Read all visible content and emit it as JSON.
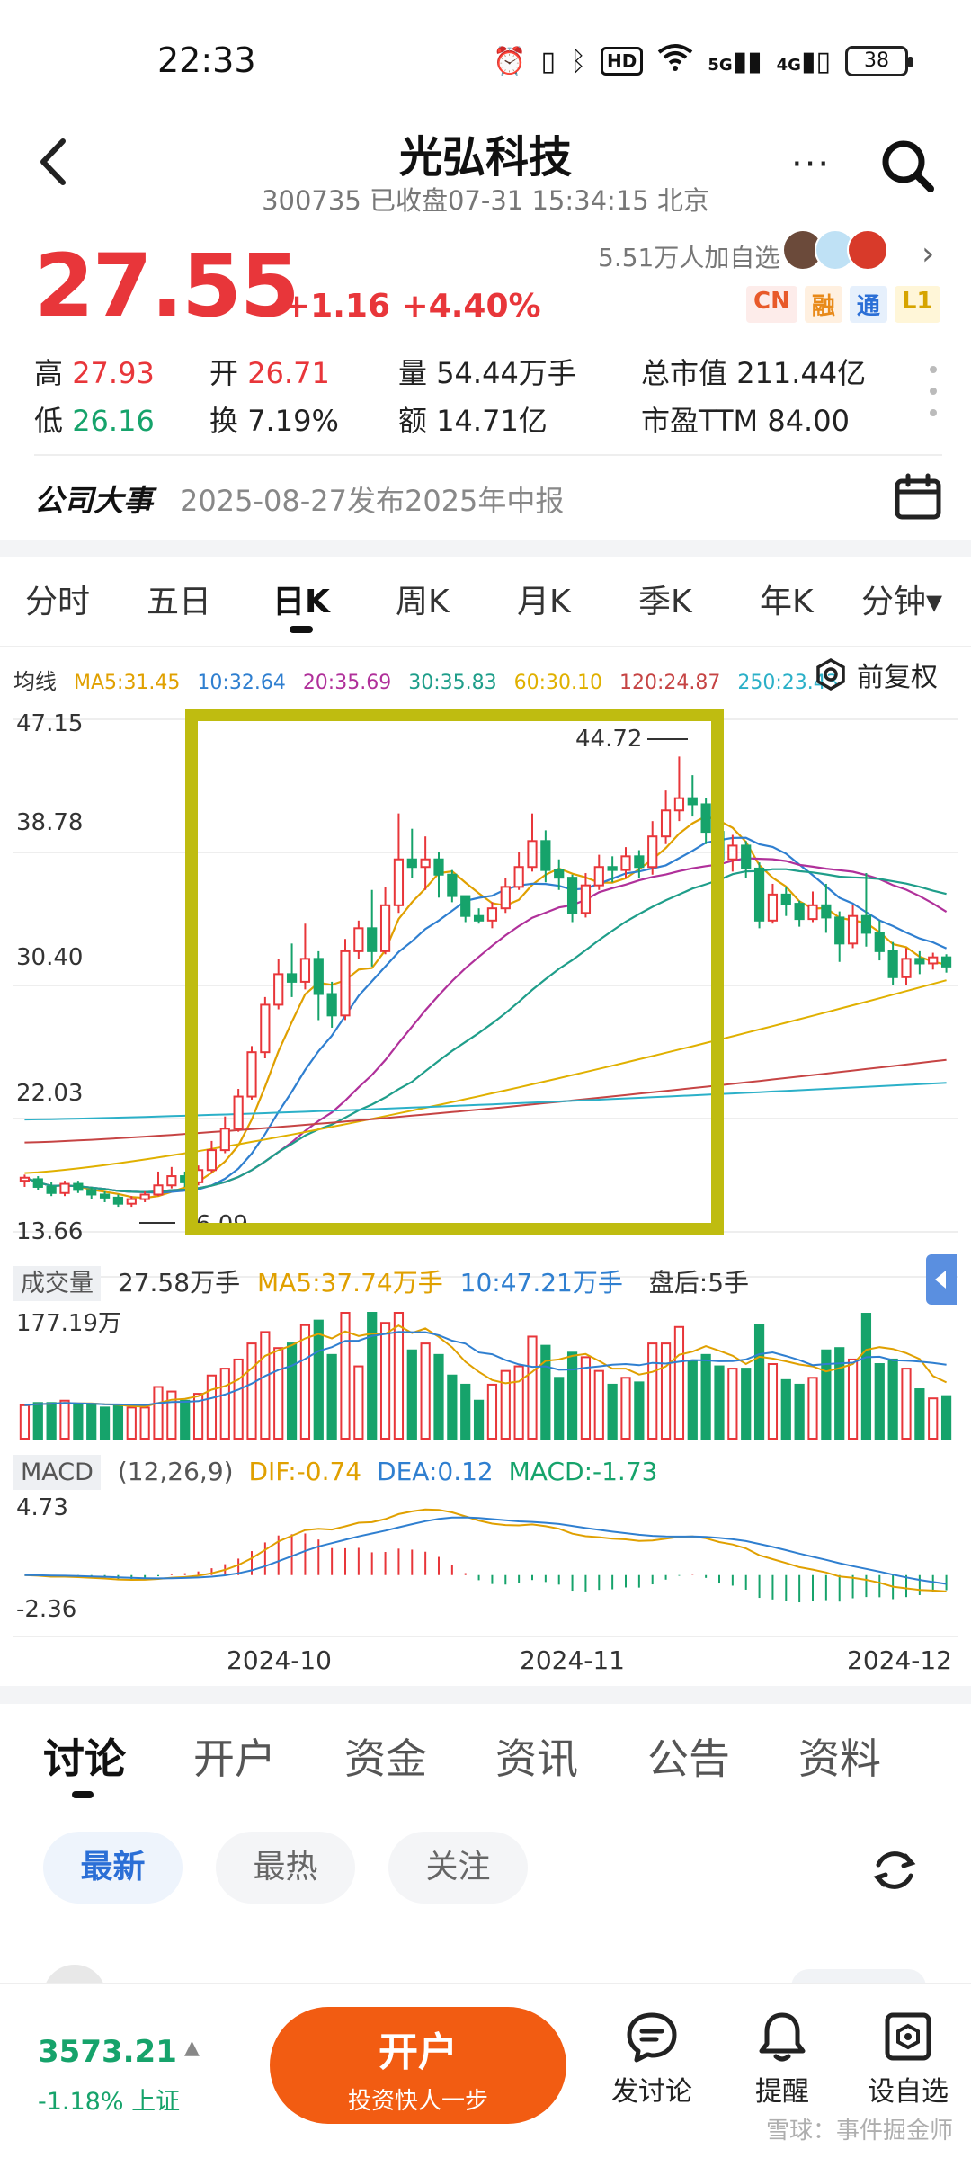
{
  "status_bar": {
    "time": "22:33",
    "network": "5G",
    "network2": "4G",
    "battery": "38",
    "hd": "HD"
  },
  "header": {
    "title": "光弘科技",
    "subtitle": "300735 已收盘07-31 15:34:15 北京",
    "more": "···"
  },
  "quote": {
    "price": "27.55",
    "change": "+1.16 +4.40%",
    "followers": "5.51万人加自选",
    "badges": [
      "CN",
      "融",
      "通",
      "L1"
    ],
    "stats": {
      "high_label": "高",
      "high": "27.93",
      "open_label": "开",
      "open": "26.71",
      "volume_label": "量",
      "volume": "54.44万手",
      "mktcap_label": "总市值",
      "mktcap": "211.44亿",
      "low_label": "低",
      "low": "26.16",
      "turnover_label": "换",
      "turnover": "7.19%",
      "amount_label": "额",
      "amount": "14.71亿",
      "pe_label": "市盈TTM",
      "pe": "84.00"
    }
  },
  "event": {
    "title": "公司大事",
    "text": "2025-08-27发布2025年中报"
  },
  "period_tabs": [
    "分时",
    "五日",
    "日K",
    "周K",
    "月K",
    "季K",
    "年K",
    "分钟▾"
  ],
  "ma_legend": {
    "label": "均线",
    "items": [
      {
        "text": "MA5:31.45",
        "color": "#e0a000"
      },
      {
        "text": "10:32.64",
        "color": "#2f7fd0"
      },
      {
        "text": "20:35.69",
        "color": "#b0309a"
      },
      {
        "text": "30:35.83",
        "color": "#1f9e8a"
      },
      {
        "text": "60:30.10",
        "color": "#e0b000"
      },
      {
        "text": "120:24.87",
        "color": "#c64444"
      },
      {
        "text": "250:23.43",
        "color": "#2bb0c8"
      }
    ],
    "adjust": "前复权"
  },
  "chart_axes": {
    "y_labels": [
      "47.15",
      "38.78",
      "30.40",
      "22.03",
      "13.66"
    ],
    "high_marker": "44.72",
    "low_marker": "6.09",
    "vol_max": "177.19万",
    "macd_max": "4.73",
    "macd_min": "-2.36",
    "dates": [
      "2024-10",
      "2024-11",
      "2024-12"
    ]
  },
  "volume": {
    "tag": "成交量",
    "value": "27.58万手",
    "ma5": "MA5:37.74万手",
    "ma10": "10:47.21万手",
    "after_hours": "盘后:5手"
  },
  "macd": {
    "tag": "MACD",
    "params": "(12,26,9)",
    "dif": "DIF:-0.74",
    "dea": "DEA:0.12",
    "macd": "MACD:-1.73"
  },
  "chart_data": {
    "type": "candlestick",
    "ylim": [
      13.66,
      47.15
    ],
    "candles": [
      [
        17.0,
        17.2,
        16.6,
        17.4
      ],
      [
        17.1,
        16.6,
        16.4,
        17.3
      ],
      [
        16.6,
        16.2,
        16.0,
        16.9
      ],
      [
        16.2,
        16.8,
        16.0,
        17.0
      ],
      [
        16.8,
        16.4,
        16.2,
        17.0
      ],
      [
        16.4,
        16.1,
        15.8,
        16.6
      ],
      [
        16.1,
        15.9,
        15.6,
        16.3
      ],
      [
        15.9,
        15.5,
        15.3,
        16.1
      ],
      [
        15.5,
        15.8,
        15.3,
        16.0
      ],
      [
        15.8,
        16.1,
        15.6,
        16.3
      ],
      [
        16.1,
        16.7,
        16.0,
        17.6
      ],
      [
        16.7,
        17.3,
        16.5,
        17.9
      ],
      [
        17.3,
        16.9,
        16.6,
        17.6
      ],
      [
        16.9,
        17.7,
        16.7,
        18.0
      ],
      [
        17.7,
        19.0,
        17.5,
        19.6
      ],
      [
        19.0,
        20.4,
        18.8,
        21.2
      ],
      [
        20.4,
        22.5,
        20.2,
        23.0
      ],
      [
        22.5,
        25.4,
        22.3,
        25.8
      ],
      [
        25.4,
        28.5,
        25.0,
        29.0
      ],
      [
        28.5,
        30.5,
        28.2,
        31.5
      ],
      [
        30.5,
        30.0,
        29.0,
        32.5
      ],
      [
        30.0,
        31.5,
        29.5,
        33.8
      ],
      [
        31.5,
        29.2,
        27.5,
        32.0
      ],
      [
        29.2,
        27.8,
        27.0,
        30.0
      ],
      [
        27.8,
        32.0,
        27.5,
        32.8
      ],
      [
        32.0,
        33.5,
        31.5,
        34.0
      ],
      [
        33.5,
        32.0,
        31.0,
        36.0
      ],
      [
        32.0,
        35.0,
        31.8,
        36.2
      ],
      [
        35.0,
        38.0,
        34.5,
        41.0
      ],
      [
        38.0,
        37.5,
        36.8,
        40.0
      ],
      [
        37.5,
        38.0,
        36.0,
        39.5
      ],
      [
        38.0,
        37.0,
        35.5,
        38.5
      ],
      [
        37.0,
        35.6,
        35.2,
        37.3
      ],
      [
        35.6,
        34.3,
        33.9,
        35.6
      ],
      [
        34.3,
        34.0,
        33.8,
        34.8
      ],
      [
        34.0,
        34.8,
        33.5,
        35.2
      ],
      [
        34.8,
        36.2,
        34.5,
        36.8
      ],
      [
        36.2,
        37.5,
        36.0,
        38.5
      ],
      [
        37.5,
        39.2,
        37.2,
        41.0
      ],
      [
        39.2,
        37.3,
        36.5,
        39.9
      ],
      [
        37.3,
        36.8,
        36.0,
        38.0
      ],
      [
        36.8,
        34.5,
        33.9,
        37.0
      ],
      [
        34.5,
        36.3,
        34.2,
        37.1
      ],
      [
        36.3,
        37.5,
        36.0,
        38.3
      ],
      [
        37.5,
        37.3,
        36.5,
        38.2
      ],
      [
        37.3,
        38.2,
        36.8,
        38.8
      ],
      [
        38.2,
        37.5,
        36.8,
        38.6
      ],
      [
        37.5,
        39.5,
        37.0,
        40.5
      ],
      [
        39.5,
        41.2,
        39.0,
        42.5
      ],
      [
        41.2,
        42.0,
        40.5,
        44.72
      ],
      [
        42.0,
        41.6,
        40.8,
        43.5
      ],
      [
        41.6,
        39.8,
        39.0,
        42.0
      ],
      [
        39.8,
        38.0,
        37.5,
        40.0
      ],
      [
        38.0,
        38.9,
        37.2,
        39.6
      ],
      [
        38.9,
        37.4,
        36.8,
        39.2
      ],
      [
        37.4,
        34.0,
        33.5,
        37.8
      ],
      [
        34.0,
        35.7,
        33.8,
        36.4
      ],
      [
        35.7,
        35.1,
        34.3,
        36.2
      ],
      [
        35.1,
        34.1,
        33.6,
        35.3
      ],
      [
        34.1,
        35.0,
        33.9,
        35.9
      ],
      [
        35.0,
        34.2,
        33.2,
        36.4
      ],
      [
        34.2,
        32.5,
        31.3,
        34.6
      ],
      [
        32.5,
        34.3,
        32.2,
        35.0
      ],
      [
        34.3,
        33.2,
        32.3,
        37.1
      ],
      [
        33.2,
        32.0,
        31.4,
        34.0
      ],
      [
        32.0,
        30.3,
        29.8,
        32.6
      ],
      [
        30.3,
        31.5,
        29.8,
        32.2
      ],
      [
        31.5,
        31.2,
        30.5,
        32.0
      ],
      [
        31.2,
        31.6,
        30.8,
        31.9
      ],
      [
        31.6,
        31.0,
        30.6,
        31.8
      ]
    ],
    "volume_max": 177.19,
    "volume_ma_labels": {
      "ma5": 37.74,
      "ma10": 47.21
    },
    "macd_range": [
      -2.36,
      4.73
    ],
    "x_ticks": [
      "2024-10",
      "2024-11",
      "2024-12"
    ]
  },
  "info_tabs": [
    "讨论",
    "开户",
    "资金",
    "资讯",
    "公告",
    "资料"
  ],
  "filters": [
    "最新",
    "最热",
    "关注"
  ],
  "bottom_bar": {
    "index_value": "3573.21",
    "index_change": "-1.18% 上证",
    "open_account_main": "开户",
    "open_account_sub": "投资快人一步",
    "actions": [
      "发讨论",
      "提醒",
      "设自选"
    ],
    "watermark": "雪球：事件掘金师"
  }
}
